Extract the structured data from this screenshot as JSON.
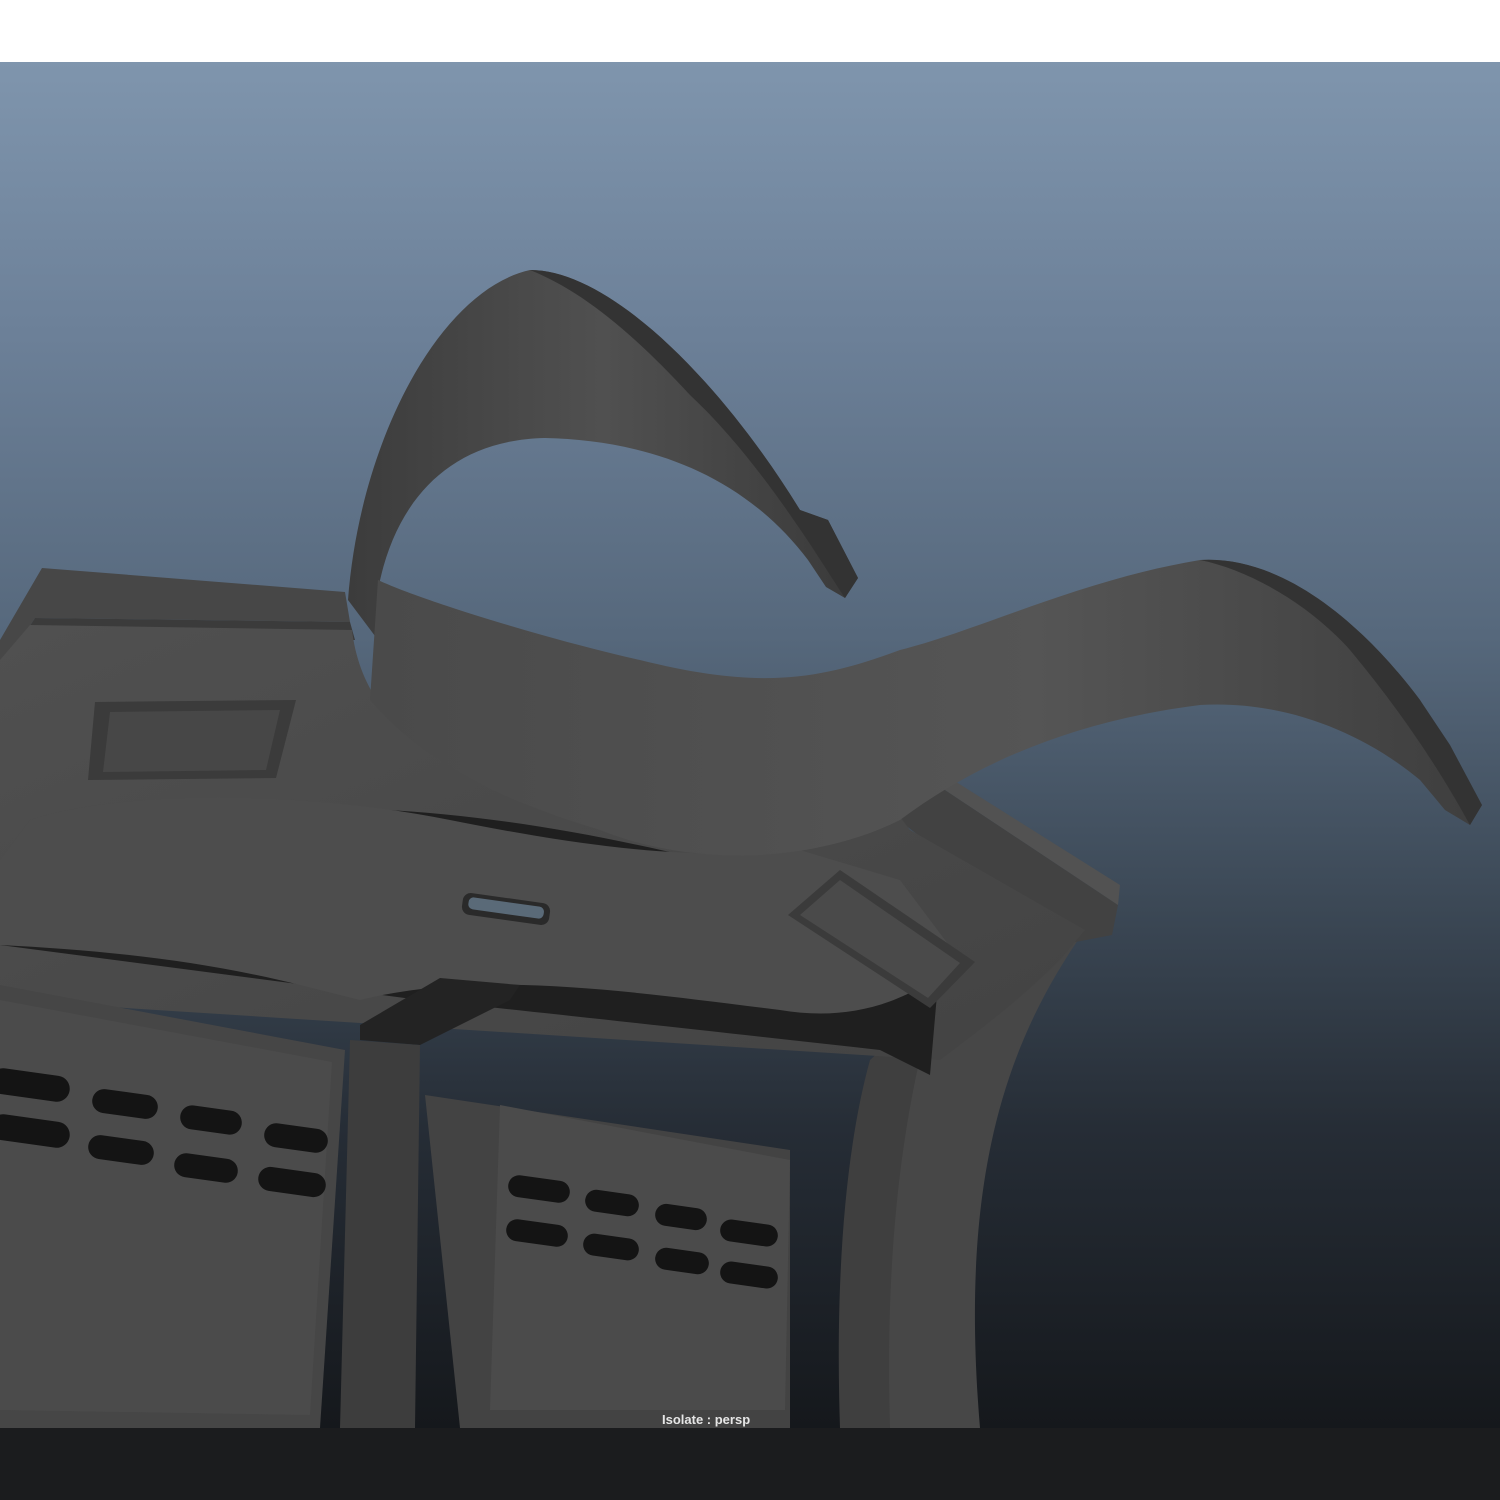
{
  "viewport": {
    "hud_label": "Isolate : persp",
    "camera": "persp",
    "background_gradient": [
      "#7f95ad",
      "#6c8098",
      "#56687c",
      "#3e4b59",
      "#262d36",
      "#15181c"
    ]
  },
  "model": {
    "base_color": "#4a4a4a",
    "shadow_color": "#1e1e1e",
    "highlight_color": "#5c5c5c"
  },
  "chrome": {
    "top_border_color": "#ffffff",
    "bottom_bar_color": "#1b1c1e"
  }
}
